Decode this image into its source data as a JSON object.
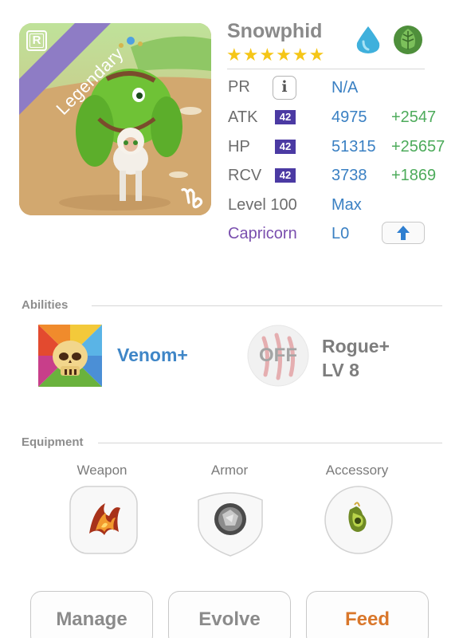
{
  "monster": {
    "name": "Snowphid",
    "stars": "★★★★★★",
    "rarity_label": "Legendary",
    "rarity_icon_letter": "R",
    "elements": [
      "water-drop-icon",
      "leaf-icon"
    ],
    "sign_icon": "capricorn-sign-icon"
  },
  "stats": {
    "pr": {
      "label": "PR",
      "value": "N/A",
      "icon": "info-icon",
      "icon_glyph": "i"
    },
    "atk": {
      "label": "ATK",
      "badge": "42",
      "value": "4975",
      "bonus": "+2547"
    },
    "hp": {
      "label": "HP",
      "badge": "42",
      "value": "51315",
      "bonus": "+25657"
    },
    "rcv": {
      "label": "RCV",
      "badge": "42",
      "value": "3738",
      "bonus": "+1869"
    },
    "level": {
      "label": "Level 100",
      "value": "Max"
    },
    "constellation": {
      "label": "Capricorn",
      "value": "L0",
      "button_icon": "arrow-up-icon"
    }
  },
  "abilities": {
    "title": "Abilities",
    "items": [
      {
        "name": "Venom+",
        "icon": "skull-icon"
      },
      {
        "status": "OFF",
        "name": "Rogue+",
        "level": "LV 8",
        "icon": "claw-marks-icon"
      }
    ]
  },
  "equipment": {
    "title": "Equipment",
    "slots": [
      {
        "label": "Weapon",
        "icon": "flame-claw-icon"
      },
      {
        "label": "Armor",
        "icon": "stone-orb-icon"
      },
      {
        "label": "Accessory",
        "icon": "leaf-ring-icon"
      }
    ]
  },
  "actions": {
    "manage": "Manage",
    "evolve": "Evolve",
    "feed": "Feed"
  },
  "colors": {
    "stat_value": "#3a80c3",
    "stat_bonus": "#4dab5b",
    "level_badge": "#4b3aa3",
    "constellation": "#7a4fae",
    "star": "#f5c618",
    "feed_text": "#d9772b"
  }
}
